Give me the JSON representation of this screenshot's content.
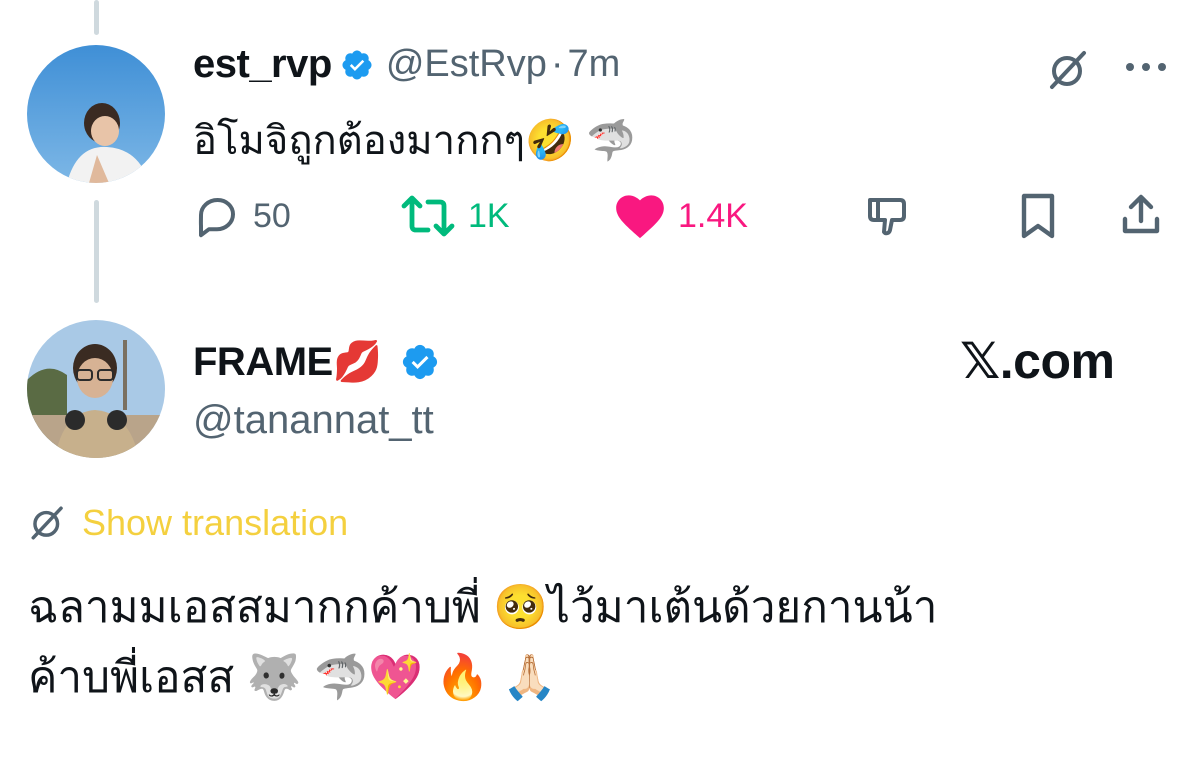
{
  "parent_tweet": {
    "display_name": "est_rvp",
    "handle": "@EstRvp",
    "separator": "·",
    "time": "7m",
    "text": "อิโมจิถูกต้องมากกๆ🤣 🦈",
    "icons": [
      "grok-icon",
      "more-icon",
      "verified-badge-icon"
    ],
    "actions": {
      "replies": "50",
      "retweets": "1K",
      "likes": "1.4K"
    }
  },
  "reply_tweet": {
    "display_name": "FRAME💋",
    "handle": "@tanannat_tt",
    "watermark": "𝕏.com",
    "translation_label": "Show translation",
    "text_line1": "ฉลามมเอสสมากกค้าบพี่ 🥺ไว้มาเต้นด้วยกานน้า",
    "text_line2": "ค้าบพี่เอสส 🐺 🦈💖 🔥 🙏🏻"
  },
  "colors": {
    "retweet_green": "#00ba7c",
    "like_pink": "#f91880",
    "verified_blue": "#1d9bf0",
    "translation_yellow": "#f4d03f",
    "muted_gray": "#536471"
  }
}
